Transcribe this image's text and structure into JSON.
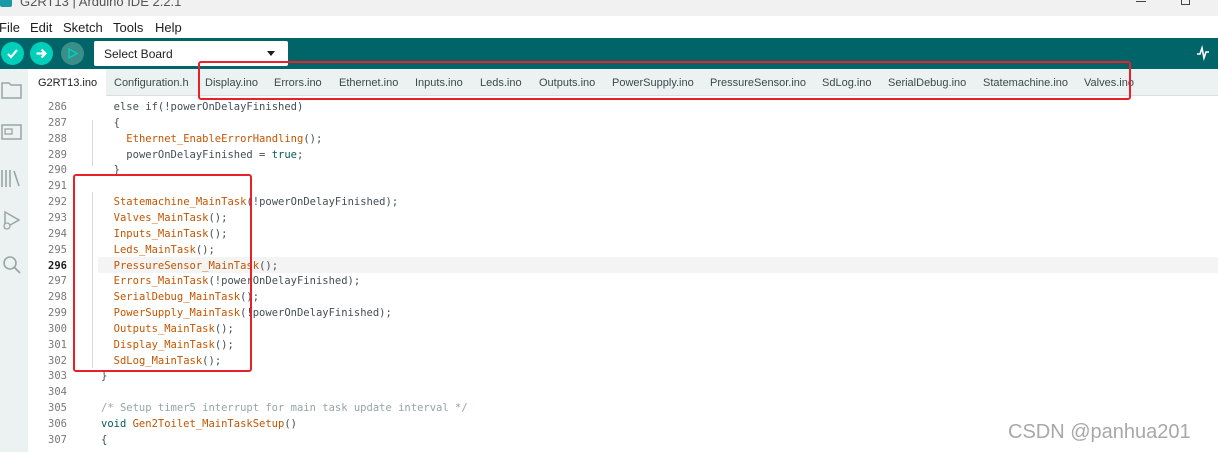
{
  "window": {
    "title": "G2RT13 | Arduino IDE 2.2.1"
  },
  "menu": [
    "File",
    "Edit",
    "Sketch",
    "Tools",
    "Help"
  ],
  "toolbar": {
    "board_select": "Select Board",
    "icons": [
      "verify-icon",
      "upload-icon",
      "debug-icon",
      "serial-plotter-icon"
    ]
  },
  "sidebar": [
    "sketchbook-icon",
    "boards-manager-icon",
    "library-manager-icon",
    "debug-icon",
    "search-icon"
  ],
  "tabs": [
    "G2RT13.ino",
    "Configuration.h",
    "Display.ino",
    "Errors.ino",
    "Ethernet.ino",
    "Inputs.ino",
    "Leds.ino",
    "Outputs.ino",
    "PowerSupply.ino",
    "PressureSensor.ino",
    "SdLog.ino",
    "SerialDebug.ino",
    "Statemachine.ino",
    "Valves.ino"
  ],
  "active_tab": "G2RT13.ino",
  "current_line": "296",
  "code_lines": [
    {
      "n": "286",
      "indent": "  ",
      "segs": [
        {
          "t": "else if(!powerOnDelayFinished)",
          "c": "txt"
        }
      ]
    },
    {
      "n": "287",
      "indent": "  ",
      "segs": [
        {
          "t": "{",
          "c": "txt"
        }
      ]
    },
    {
      "n": "288",
      "indent": "    ",
      "segs": [
        {
          "t": "Ethernet_EnableErrorHandling",
          "c": "fn"
        },
        {
          "t": "();",
          "c": "txt"
        }
      ]
    },
    {
      "n": "289",
      "indent": "    ",
      "segs": [
        {
          "t": "powerOnDelayFinished = ",
          "c": "txt"
        },
        {
          "t": "true",
          "c": "kw"
        },
        {
          "t": ";",
          "c": "txt"
        }
      ]
    },
    {
      "n": "290",
      "indent": "  ",
      "segs": [
        {
          "t": "}",
          "c": "txt"
        }
      ]
    },
    {
      "n": "291",
      "indent": "",
      "segs": []
    },
    {
      "n": "292",
      "indent": "  ",
      "segs": [
        {
          "t": "Statemachine_MainTask",
          "c": "fn"
        },
        {
          "t": "(!powerOnDelayFinished);",
          "c": "txt"
        }
      ]
    },
    {
      "n": "293",
      "indent": "  ",
      "segs": [
        {
          "t": "Valves_MainTask",
          "c": "fn"
        },
        {
          "t": "();",
          "c": "txt"
        }
      ]
    },
    {
      "n": "294",
      "indent": "  ",
      "segs": [
        {
          "t": "Inputs_MainTask",
          "c": "fn"
        },
        {
          "t": "();",
          "c": "txt"
        }
      ]
    },
    {
      "n": "295",
      "indent": "  ",
      "segs": [
        {
          "t": "Leds_MainTask",
          "c": "fn"
        },
        {
          "t": "();",
          "c": "txt"
        }
      ]
    },
    {
      "n": "296",
      "indent": "  ",
      "segs": [
        {
          "t": "PressureSensor_MainTask",
          "c": "fn"
        },
        {
          "t": "();",
          "c": "txt"
        }
      ]
    },
    {
      "n": "297",
      "indent": "  ",
      "segs": [
        {
          "t": "Errors_MainTask",
          "c": "fn"
        },
        {
          "t": "(!powerOnDelayFinished);",
          "c": "txt"
        }
      ]
    },
    {
      "n": "298",
      "indent": "  ",
      "segs": [
        {
          "t": "SerialDebug_MainTask",
          "c": "fn"
        },
        {
          "t": "();",
          "c": "txt"
        }
      ]
    },
    {
      "n": "299",
      "indent": "  ",
      "segs": [
        {
          "t": "PowerSupply_MainTask",
          "c": "fn"
        },
        {
          "t": "(!powerOnDelayFinished);",
          "c": "txt"
        }
      ]
    },
    {
      "n": "300",
      "indent": "  ",
      "segs": [
        {
          "t": "Outputs_MainTask",
          "c": "fn"
        },
        {
          "t": "();",
          "c": "txt"
        }
      ]
    },
    {
      "n": "301",
      "indent": "  ",
      "segs": [
        {
          "t": "Display_MainTask",
          "c": "fn"
        },
        {
          "t": "();",
          "c": "txt"
        }
      ]
    },
    {
      "n": "302",
      "indent": "  ",
      "segs": [
        {
          "t": "SdLog_MainTask",
          "c": "fn"
        },
        {
          "t": "();",
          "c": "txt"
        }
      ]
    },
    {
      "n": "303",
      "indent": "",
      "segs": [
        {
          "t": "}",
          "c": "txt"
        }
      ]
    },
    {
      "n": "304",
      "indent": "",
      "segs": []
    },
    {
      "n": "305",
      "indent": "",
      "segs": [
        {
          "t": "/* Setup timer5 interrupt for main task update interval */",
          "c": "cm"
        }
      ]
    },
    {
      "n": "306",
      "indent": "",
      "segs": [
        {
          "t": "void ",
          "c": "kw"
        },
        {
          "t": "Gen2Toilet_MainTaskSetup",
          "c": "fn"
        },
        {
          "t": "()",
          "c": "txt"
        }
      ]
    },
    {
      "n": "307",
      "indent": "",
      "segs": [
        {
          "t": "{",
          "c": "txt"
        }
      ]
    }
  ],
  "colors": {
    "toolbar": "#006468",
    "button": "#00cfb9",
    "function": "#c45500",
    "keyword": "#005c5f",
    "comment": "#95a5a6",
    "annotation": "#e8202a"
  },
  "watermark": "CSDN @panhua201"
}
